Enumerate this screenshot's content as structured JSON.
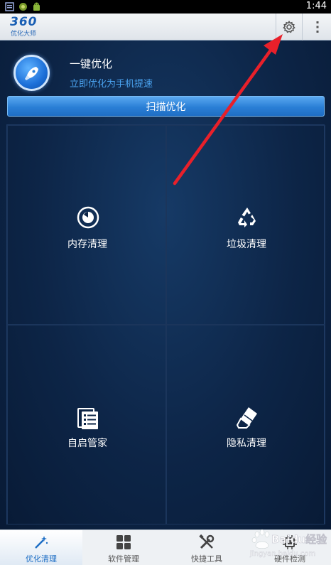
{
  "status_bar": {
    "time": "1:44",
    "icons": [
      "notification-icon",
      "game-icon",
      "android-icon"
    ]
  },
  "app_bar": {
    "logo_main": "360",
    "logo_sub": "优化大师",
    "settings_icon": "gear-icon",
    "menu_icon": "overflow-menu-icon"
  },
  "hero": {
    "title": "一键优化",
    "subtitle": "立即优化为手机提速",
    "icon": "rocket-icon"
  },
  "scan_button": {
    "label": "扫描优化"
  },
  "tiles": [
    {
      "label": "内存清理",
      "icon": "memory-icon"
    },
    {
      "label": "垃圾清理",
      "icon": "recycle-icon"
    },
    {
      "label": "自启管家",
      "icon": "startup-list-icon"
    },
    {
      "label": "隐私清理",
      "icon": "eraser-icon"
    }
  ],
  "bottom_nav": [
    {
      "label": "优化清理",
      "icon": "magic-wand-icon",
      "active": true
    },
    {
      "label": "软件管理",
      "icon": "apps-grid-icon",
      "active": false
    },
    {
      "label": "快捷工具",
      "icon": "tools-icon",
      "active": false
    },
    {
      "label": "硬件检测",
      "icon": "hardware-icon",
      "active": false
    }
  ],
  "watermark": {
    "brand": "Baidu经验",
    "url": "jingyan.baidu.com"
  },
  "colors": {
    "accent": "#2a7fd6",
    "subtitle": "#4aa3f0",
    "annotation_arrow": "#e8202a",
    "background": "#0d2547"
  }
}
